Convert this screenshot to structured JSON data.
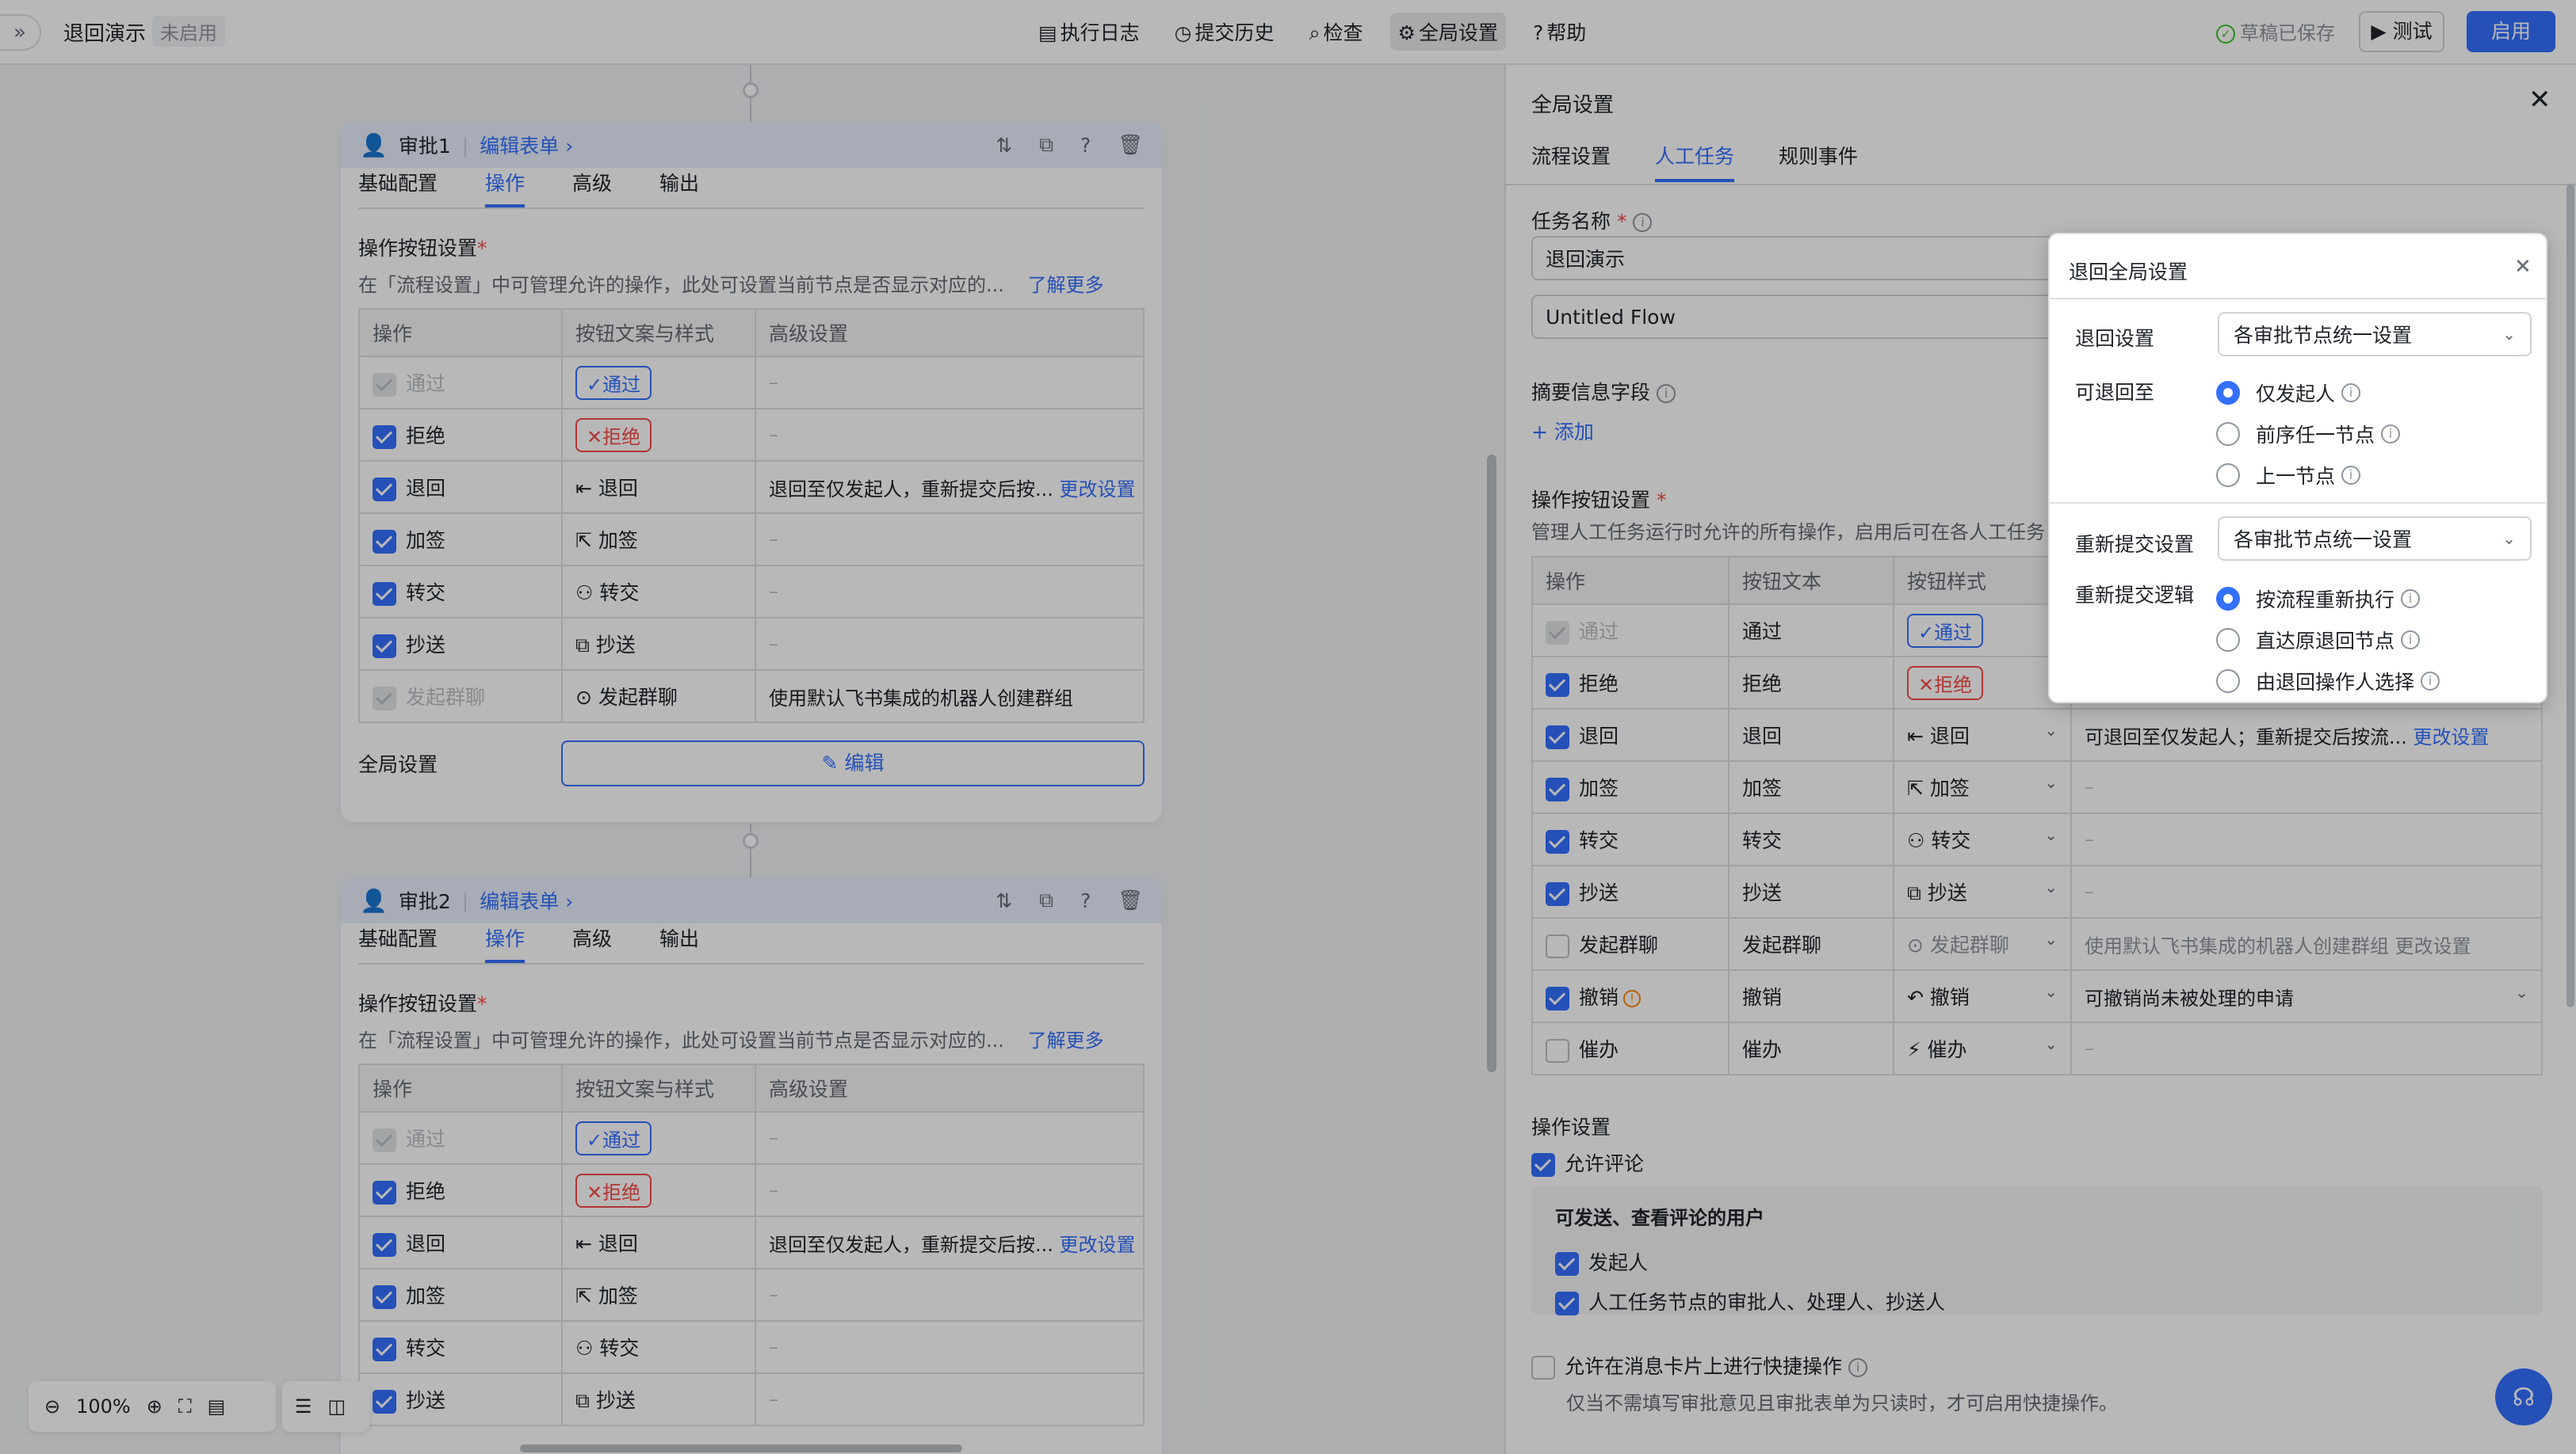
{
  "topbar": {
    "flow_name": "退回演示",
    "status": "未启用",
    "menu": [
      {
        "icon": "log-icon",
        "label": "执行日志"
      },
      {
        "icon": "history-icon",
        "label": "提交历史"
      },
      {
        "icon": "check-icon",
        "label": "检查"
      },
      {
        "icon": "gear-icon",
        "label": "全局设置"
      },
      {
        "icon": "help-icon",
        "label": "帮助"
      }
    ],
    "saved_label": "草稿已保存",
    "test_label": "测试",
    "enable_label": "启用"
  },
  "node_tabs": [
    "基础配置",
    "操作",
    "高级",
    "输出"
  ],
  "node1": {
    "title": "审批1",
    "edit_form": "编辑表单",
    "section_title": "操作按钮设置",
    "section_desc": "在「流程设置」中可管理允许的操作，此处可设置当前节点是否显示对应的...",
    "learn_more": "了解更多",
    "headers": [
      "操作",
      "按钮文案与样式",
      "高级设置"
    ],
    "rows": [
      {
        "op": "通过",
        "state": "dis",
        "btn": "通过",
        "btn_style": "tag-b",
        "btn_icon": "✓",
        "adv": "–"
      },
      {
        "op": "拒绝",
        "state": "on",
        "btn": "拒绝",
        "btn_style": "tag-r",
        "btn_icon": "✕",
        "adv": "–"
      },
      {
        "op": "退回",
        "state": "on",
        "btn": "退回",
        "btn_style": "plain",
        "btn_icon": "⇤",
        "adv": "退回至仅发起人，重新提交后按...",
        "adv_link": "更改设置"
      },
      {
        "op": "加签",
        "state": "on",
        "btn": "加签",
        "btn_style": "plain",
        "btn_icon": "⇱",
        "adv": "–"
      },
      {
        "op": "转交",
        "state": "on",
        "btn": "转交",
        "btn_style": "plain",
        "btn_icon": "⚇",
        "adv": "–"
      },
      {
        "op": "抄送",
        "state": "on",
        "btn": "抄送",
        "btn_style": "plain",
        "btn_icon": "⧉",
        "adv": "–"
      },
      {
        "op": "发起群聊",
        "state": "dis",
        "btn": "发起群聊",
        "btn_style": "plain",
        "btn_icon": "⊙",
        "adv": "使用默认飞书集成的机器人创建群组"
      }
    ],
    "global_label": "全局设置",
    "edit_button": "编辑"
  },
  "node2": {
    "title": "审批2",
    "edit_form": "编辑表单",
    "section_title": "操作按钮设置",
    "section_desc": "在「流程设置」中可管理允许的操作，此处可设置当前节点是否显示对应的...",
    "learn_more": "了解更多",
    "headers": [
      "操作",
      "按钮文案与样式",
      "高级设置"
    ],
    "rows": [
      {
        "op": "通过",
        "state": "dis",
        "btn": "通过",
        "btn_style": "tag-b",
        "btn_icon": "✓",
        "adv": "–"
      },
      {
        "op": "拒绝",
        "state": "on",
        "btn": "拒绝",
        "btn_style": "tag-r",
        "btn_icon": "✕",
        "adv": "–"
      },
      {
        "op": "退回",
        "state": "on",
        "btn": "退回",
        "btn_style": "plain",
        "btn_icon": "⇤",
        "adv": "退回至仅发起人，重新提交后按...",
        "adv_link": "更改设置"
      },
      {
        "op": "加签",
        "state": "on",
        "btn": "加签",
        "btn_style": "plain",
        "btn_icon": "⇱",
        "adv": "–"
      },
      {
        "op": "转交",
        "state": "on",
        "btn": "转交",
        "btn_style": "plain",
        "btn_icon": "⚇",
        "adv": "–"
      },
      {
        "op": "抄送",
        "state": "on",
        "btn": "抄送",
        "btn_style": "plain",
        "btn_icon": "⧉",
        "adv": "–"
      }
    ]
  },
  "zoom": {
    "value": "100%"
  },
  "panel": {
    "title": "全局设置",
    "tabs": [
      "流程设置",
      "人工任务",
      "规则事件"
    ],
    "active_tab": 1,
    "task_name_label": "任务名称",
    "task_name_value": "退回演示",
    "flow_name_value": "Untitled Flow",
    "summary_label": "摘要信息字段",
    "add_label": "+ 添加",
    "ops_title": "操作按钮设置",
    "ops_desc": "管理人工任务运行时允许的所有操作，启用后可在各人工任务",
    "ops_headers": [
      "操作",
      "按钮文本",
      "按钮样式"
    ],
    "ops_rows": [
      {
        "op": "通过",
        "state": "dis",
        "text": "通过",
        "btn": "通过",
        "btn_style": "tag-b",
        "btn_icon": "✓",
        "adv": ""
      },
      {
        "op": "拒绝",
        "state": "on",
        "text": "拒绝",
        "btn": "拒绝",
        "btn_style": "tag-r",
        "btn_icon": "✕",
        "adv": ""
      },
      {
        "op": "退回",
        "state": "on",
        "text": "退回",
        "btn": "退回",
        "btn_style": "plain",
        "btn_icon": "⇤",
        "adv": "可退回至仅发起人；重新提交后按流...",
        "adv_link": "更改设置"
      },
      {
        "op": "加签",
        "state": "on",
        "text": "加签",
        "btn": "加签",
        "btn_style": "plain",
        "btn_icon": "⇱",
        "adv": "–"
      },
      {
        "op": "转交",
        "state": "on",
        "text": "转交",
        "btn": "转交",
        "btn_style": "plain",
        "btn_icon": "⚇",
        "adv": "–"
      },
      {
        "op": "抄送",
        "state": "on",
        "text": "抄送",
        "btn": "抄送",
        "btn_style": "plain",
        "btn_icon": "⧉",
        "adv": "–"
      },
      {
        "op": "发起群聊",
        "state": "off",
        "text": "发起群聊",
        "btn": "发起群聊",
        "btn_style": "plain",
        "btn_icon": "⊙",
        "adv": "使用默认飞书集成的机器人创建群组",
        "adv_link": "更改设置",
        "muted": true
      },
      {
        "op": "撤销",
        "state": "on",
        "text": "撤销",
        "btn": "撤销",
        "btn_style": "plain",
        "btn_icon": "↶",
        "adv": "可撤销尚未被处理的申请",
        "warn": true
      },
      {
        "op": "催办",
        "state": "off",
        "text": "催办",
        "btn": "催办",
        "btn_style": "plain",
        "btn_icon": "⚡",
        "adv": "–"
      }
    ],
    "op_settings_title": "操作设置",
    "allow_comment": "允许评论",
    "comment_users_title": "可发送、查看评论的用户",
    "comment_users": [
      "发起人",
      "人工任务节点的审批人、处理人、抄送人"
    ],
    "quick_action": "允许在消息卡片上进行快捷操作",
    "quick_action_desc": "仅当不需填写审批意见且审批表单为只读时，才可启用快捷操作。"
  },
  "popup": {
    "title": "退回全局设置",
    "return_setting_label": "退回设置",
    "return_setting_value": "各审批节点统一设置",
    "return_to_label": "可退回至",
    "return_to_options": [
      "仅发起人",
      "前序任一节点",
      "上一节点"
    ],
    "return_to_selected": 0,
    "resubmit_label": "重新提交设置",
    "resubmit_value": "各审批节点统一设置",
    "resubmit_logic_label": "重新提交逻辑",
    "resubmit_logic_options": [
      "按流程重新执行",
      "直达原退回节点",
      "由退回操作人选择"
    ],
    "resubmit_logic_selected": 0
  },
  "colors": {
    "accent": "#3370ff",
    "danger": "#f54a45",
    "warn": "#ff8800",
    "success": "#34c724"
  }
}
